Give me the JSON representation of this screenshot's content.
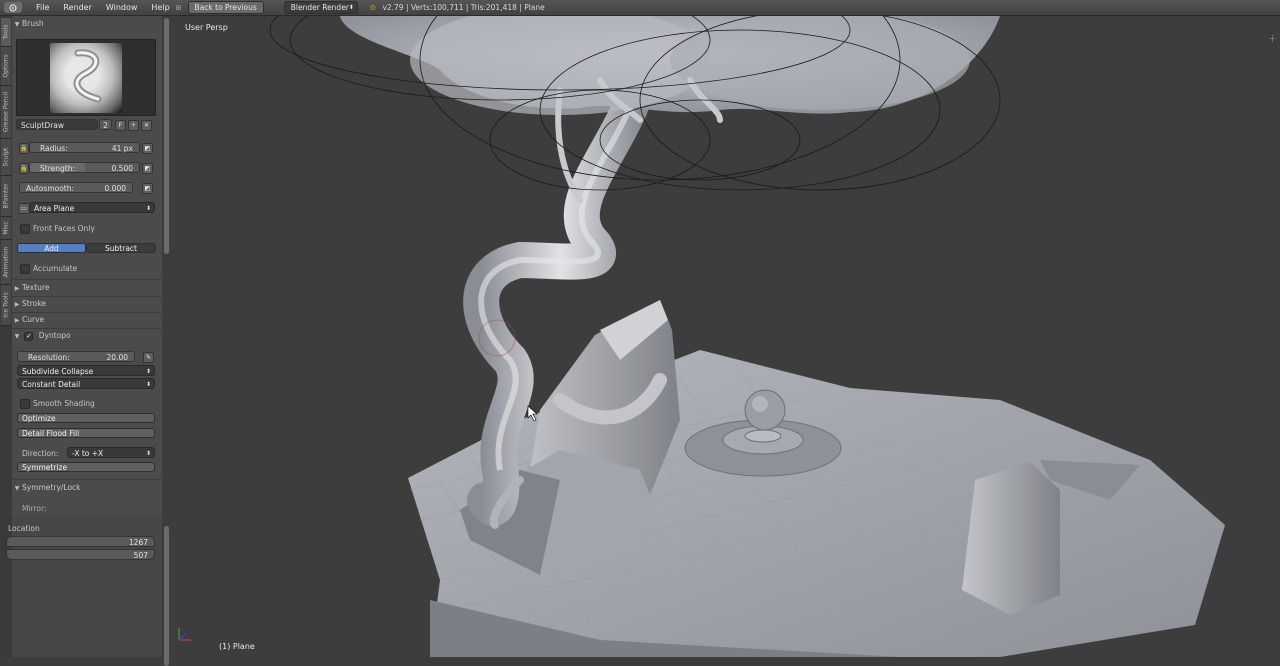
{
  "topbar": {
    "menus": [
      "File",
      "Render",
      "Window",
      "Help"
    ],
    "back_button": "Back to Previous",
    "render_engine": "Blender Render",
    "stats": "v2.79 | Verts:100,711 | Tris:201,418 | Plane"
  },
  "vtabs": [
    "Tools",
    "Options",
    "Grease Pencil",
    "Sculpt",
    "BPainter",
    "Misc",
    "Animation",
    "Ice Tools"
  ],
  "brush": {
    "header": "Brush",
    "name": "SculptDraw",
    "users": "2",
    "fake_user": "F",
    "radius_label": "Radius:",
    "radius_value": "41 px",
    "strength_label": "Strength:",
    "strength_value": "0.500",
    "strength_fraction": 0.5,
    "autosmooth_label": "Autosmooth:",
    "autosmooth_value": "0.000",
    "plane": "Area Plane",
    "front_faces": "Front Faces Only",
    "add": "Add",
    "subtract": "Subtract",
    "accumulate": "Accumulate"
  },
  "sections": {
    "texture": "Texture",
    "stroke": "Stroke",
    "curve": "Curve",
    "dyntopo": "Dyntopo",
    "symmetry": "Symmetry/Lock",
    "mirror": "Mirror:"
  },
  "dyntopo": {
    "resolution_label": "Resolution:",
    "resolution_value": "20.00",
    "method": "Subdivide Collapse",
    "detail": "Constant Detail",
    "smooth_shading": "Smooth Shading",
    "optimize": "Optimize",
    "flood_fill": "Detail Flood Fill",
    "direction_label": "Direction:",
    "direction_value": "-X to +X",
    "symmetrize": "Symmetrize"
  },
  "location": {
    "label": "Location",
    "x": "1267",
    "y": "507"
  },
  "viewport": {
    "view_name": "User Persp",
    "object_label": "(1) Plane"
  },
  "colors": {
    "accent": "#5680c2",
    "background": "#3d3d3d",
    "panel": "#4b4b4b",
    "mesh": "#a9acb3"
  }
}
